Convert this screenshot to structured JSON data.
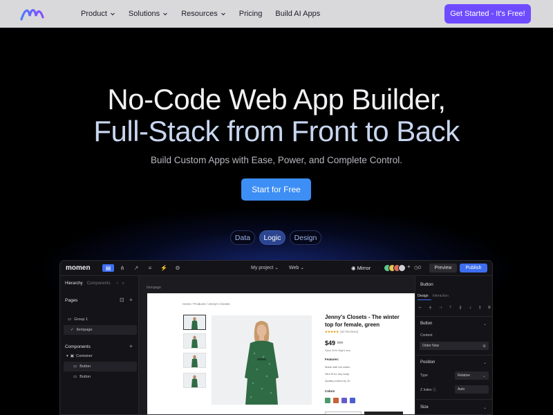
{
  "nav": {
    "items": [
      {
        "label": "Product",
        "dropdown": true
      },
      {
        "label": "Solutions",
        "dropdown": true
      },
      {
        "label": "Resources",
        "dropdown": true
      },
      {
        "label": "Pricing",
        "dropdown": false
      },
      {
        "label": "Build AI Apps",
        "dropdown": false
      }
    ],
    "cta": "Get Started - It's Free!"
  },
  "hero": {
    "line1": "No-Code Web App Builder,",
    "line2": "Full-Stack from Front to Back",
    "subtitle": "Build Custom Apps with Ease, Power, and Complete Control.",
    "button": "Start for Free",
    "tabs": [
      {
        "label": "Data",
        "active": false
      },
      {
        "label": "Logic",
        "active": true
      },
      {
        "label": "Design",
        "active": false
      }
    ]
  },
  "app": {
    "brand": "momen",
    "project": "My project",
    "device": "Web",
    "mirror": "Mirror",
    "count": "0",
    "preview": "Preview",
    "publish": "Publish",
    "left": {
      "tab_hierarchy": "Hierarchy",
      "tab_components": "Components",
      "pages_title": "Pages",
      "group": "Group 1",
      "page": "Itempage",
      "components_title": "Components",
      "container": "Container",
      "button1": "Button",
      "button2": "Button"
    },
    "canvas": {
      "label": "Itempage",
      "breadcrumb": "Home / Products / Jenny's Closets",
      "title": "Jenny's Closets - The winter top for female, green",
      "rating": "★★★★★",
      "reviews": "(62 Reviews)",
      "price": "$49",
      "old_price": "$99",
      "save": "Save 50% Right now",
      "features_title": "Features:",
      "features": [
        "Made with full cotton",
        "Slim fit for any body",
        "Quality control by JC"
      ],
      "colors_title": "Colors",
      "swatches": [
        "#4a9a6b",
        "#c8623b",
        "#6a5ac8",
        "#4a5fd0"
      ]
    },
    "right": {
      "title": "Button",
      "tab_design": "Design",
      "tab_interaction": "Interaction",
      "section_button": "Button",
      "content_label": "Content",
      "content_value": "Order Now",
      "section_position": "Position",
      "type_label": "Type",
      "type_value": "Relative",
      "zindex_label": "Z Index",
      "zindex_value": "Auto",
      "section_size": "Size"
    }
  }
}
